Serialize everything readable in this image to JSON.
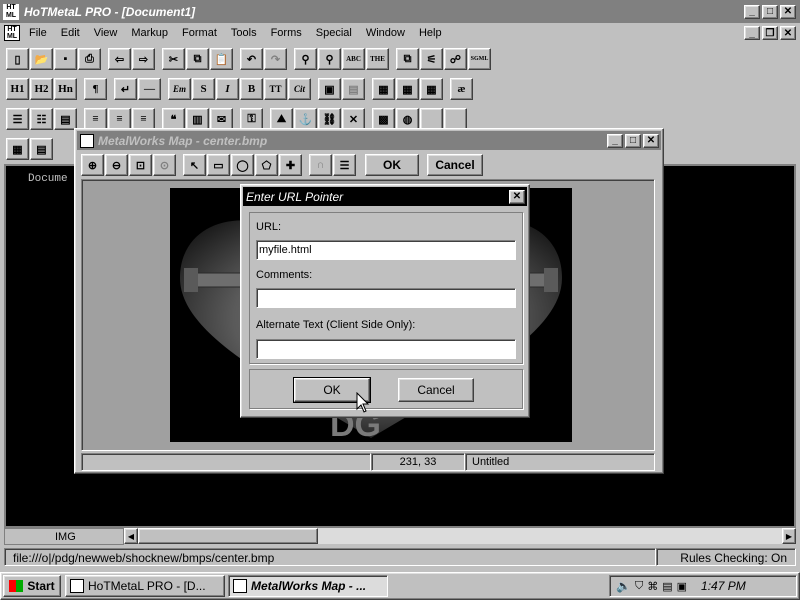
{
  "app": {
    "title": "HoTMetaL PRO - [Document1]",
    "menu": [
      "File",
      "Edit",
      "View",
      "Markup",
      "Format",
      "Tools",
      "Forms",
      "Special",
      "Window",
      "Help"
    ]
  },
  "toolbar2": {
    "h1": "H1",
    "h2": "H2",
    "hn": "Hn",
    "para": "¶",
    "em": "Em",
    "s": "S",
    "i": "I",
    "b": "B",
    "tt": "TT",
    "cit": "Cit",
    "ae": "æ"
  },
  "doc": {
    "text": "Docume",
    "status_tag": "IMG",
    "path": "file:///o|/pdg/newweb/shocknew/bmps/center.bmp",
    "rules": "Rules Checking: On"
  },
  "map_window": {
    "title": "MetalWorks Map - center.bmp",
    "ok": "OK",
    "cancel": "Cancel",
    "coords": "231, 33",
    "status": "Untitled"
  },
  "dialog": {
    "title": "Enter URL Pointer",
    "url_label": "URL:",
    "url_value": "myfile.html",
    "comments_label": "Comments:",
    "comments_value": "",
    "alt_label": "Alternate Text (Client Side Only):",
    "alt_value": "",
    "ok": "OK",
    "cancel": "Cancel"
  },
  "taskbar": {
    "start": "Start",
    "task1": "HoTMetaL PRO - [D...",
    "task2": "MetalWorks Map - ...",
    "clock": "1:47 PM"
  }
}
